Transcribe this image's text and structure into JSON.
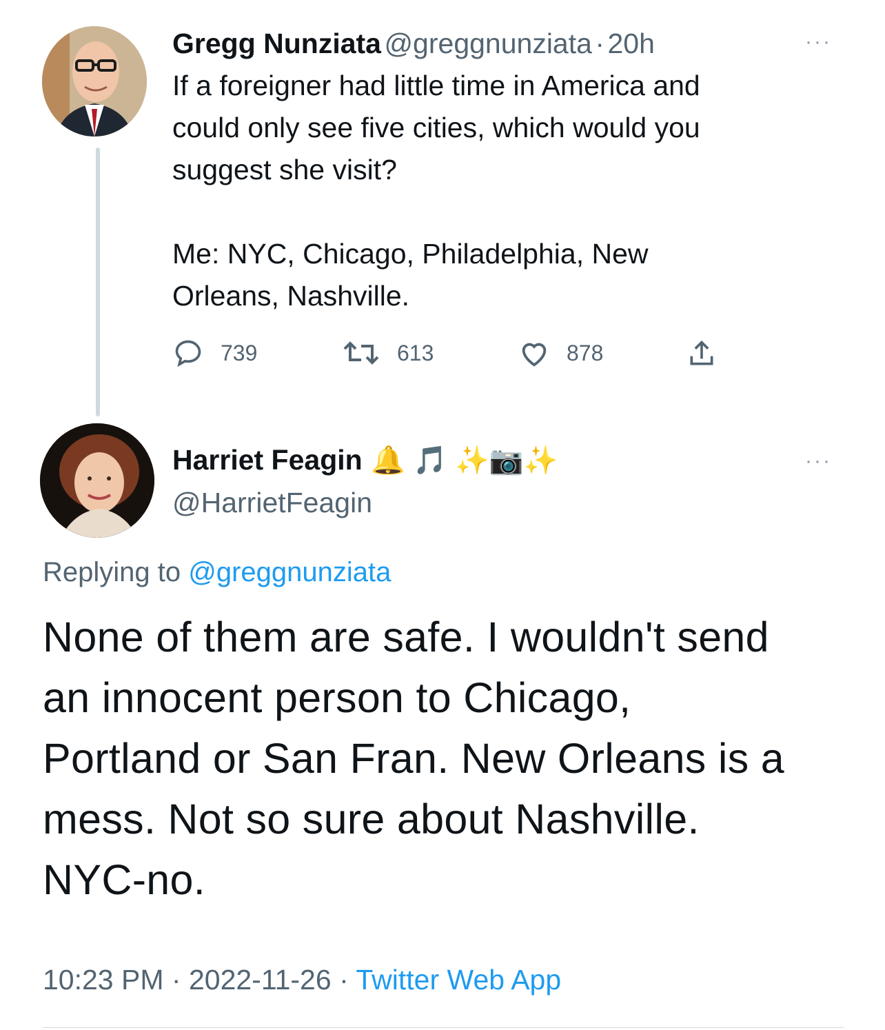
{
  "original_tweet": {
    "author_name": "Gregg Nunziata",
    "handle": "@greggnunziata",
    "separator": "·",
    "time_ago": "20h",
    "text": "If a foreigner had little time in America and\ncould only see five cities, which would you\nsuggest she visit?\n\nMe: NYC, Chicago, Philadelphia, New\nOrleans, Nashville.",
    "replies": "739",
    "retweets": "613",
    "likes": "878",
    "more_label": "···"
  },
  "reply_tweet": {
    "author_name": "Harriet Feagin",
    "name_emojis": "🔔 🎵 ✨📷✨",
    "handle": "@HarrietFeagin",
    "more_label": "···",
    "replying_to_prefix": "Replying to",
    "replying_to_handle": "@greggnunziata",
    "text": "None of them are safe.  I wouldn't send\nan innocent person to Chicago,\nPortland or San Fran.  New Orleans is a\nmess.  Not so sure about Nashville.\nNYC-no.",
    "time": "10:23 PM",
    "separator": "·",
    "date": "2022-11-26",
    "source": "Twitter Web App"
  },
  "colors": {
    "link": "#1d9bf0",
    "secondary_text": "#536471",
    "primary_text": "#0f1419"
  }
}
